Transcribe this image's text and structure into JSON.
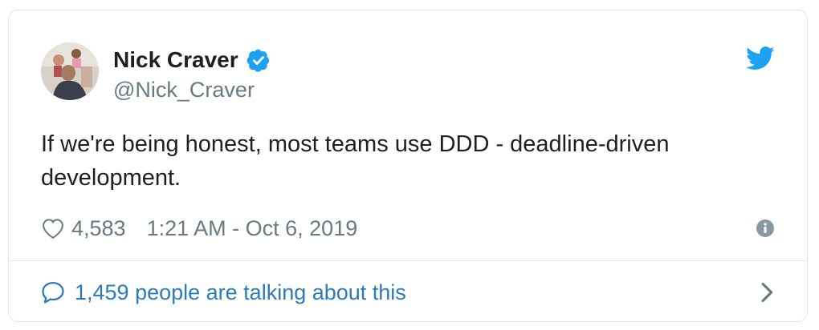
{
  "user": {
    "display_name": "Nick Craver",
    "handle": "@Nick_Craver",
    "verified": true
  },
  "tweet": {
    "text": "If we're being honest, most teams use DDD - deadline-driven development.",
    "likes": "4,583",
    "timestamp": "1:21 AM - Oct 6, 2019"
  },
  "footer": {
    "conversation_label": "1,459 people are talking about this"
  },
  "icons": {
    "brand": "twitter-bird-icon",
    "like": "heart-icon",
    "info": "info-icon",
    "reply": "speech-bubble-icon",
    "next": "chevron-right-icon",
    "verified": "verified-badge-icon"
  },
  "colors": {
    "twitter_blue": "#1da1f2",
    "link_blue": "#2b7bb9",
    "text": "#1c2022",
    "secondary_text": "#697882",
    "border": "#e1e8ed"
  }
}
